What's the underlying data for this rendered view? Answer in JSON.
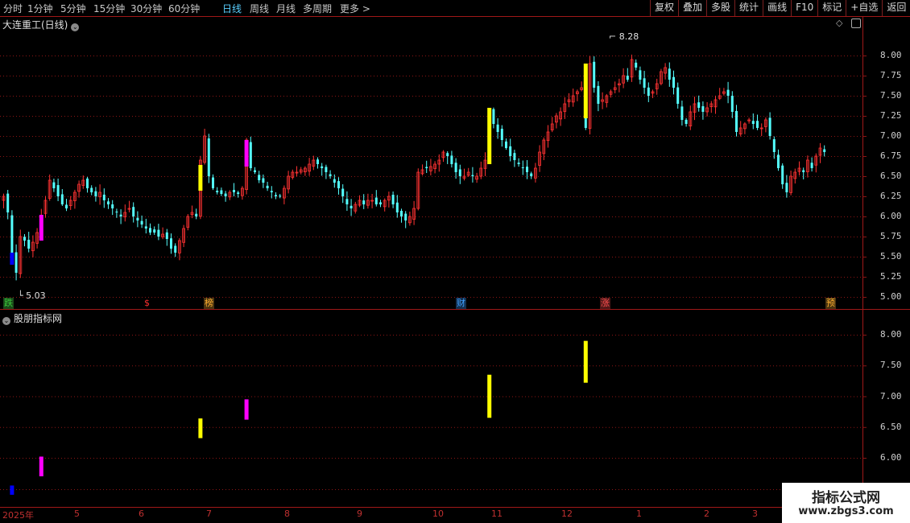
{
  "toolbar": {
    "periods": [
      "分时",
      "1分钟",
      "5分钟",
      "15分钟",
      "30分钟",
      "60分钟",
      "日线",
      "周线",
      "月线",
      "多周期",
      "更多 >"
    ],
    "active_period": "日线",
    "actions": [
      "复权",
      "叠加",
      "多股",
      "统计",
      "画线",
      "F10",
      "标记",
      "+自选",
      "返回"
    ]
  },
  "main_panel": {
    "title": "大连重工(日线)"
  },
  "indicator_panel": {
    "title": "股朋指标网"
  },
  "price_axis": [
    "8.00",
    "7.75",
    "7.50",
    "7.25",
    "7.00",
    "6.75",
    "6.50",
    "6.25",
    "6.00",
    "5.75",
    "5.50",
    "5.25",
    "5.00"
  ],
  "indicator_axis": [
    "8.00",
    "7.50",
    "7.00",
    "6.50",
    "6.00"
  ],
  "annotations": {
    "high": "8.28",
    "low": "5.03"
  },
  "event_markers": [
    {
      "label": "跌",
      "color": "#3ac83a",
      "type": "box"
    },
    {
      "label": "$",
      "color": "#ff3030",
      "type": "text"
    },
    {
      "label": "榜",
      "color": "#ffb030",
      "type": "box"
    },
    {
      "label": "财",
      "color": "#40a0ff",
      "type": "box"
    },
    {
      "label": "涨",
      "color": "#ff5050",
      "type": "box"
    },
    {
      "label": "预",
      "color": "#ffb030",
      "type": "box"
    }
  ],
  "date_axis": [
    "2025年",
    "5",
    "6",
    "7",
    "8",
    "9",
    "10",
    "11",
    "12",
    "1",
    "2",
    "3"
  ],
  "watermark": {
    "title": "指标公式网",
    "url": "www.zbgs3.com"
  },
  "colors": {
    "up": "#ff3232",
    "down": "#54ffff",
    "grid": "#8c1515",
    "signal_yellow": "#ffff00",
    "signal_magenta": "#ff00ff",
    "signal_blue": "#0000ff"
  },
  "chart_data": {
    "type": "candlestick",
    "ylim": [
      4.9,
      8.45
    ],
    "signals": [
      {
        "index": 2,
        "color": "blue",
        "low": 5.4,
        "high": 5.55
      },
      {
        "index": 9,
        "color": "magenta",
        "low": 5.7,
        "high": 6.02
      },
      {
        "index": 47,
        "color": "yellow",
        "low": 6.32,
        "high": 6.64
      },
      {
        "index": 58,
        "color": "magenta",
        "low": 6.62,
        "high": 6.95
      },
      {
        "index": 116,
        "color": "yellow",
        "low": 6.65,
        "high": 7.35
      },
      {
        "index": 139,
        "color": "yellow",
        "low": 7.22,
        "high": 7.9
      }
    ],
    "closes": [
      6.25,
      6.05,
      5.55,
      5.3,
      5.75,
      5.7,
      5.6,
      5.68,
      5.8,
      6.0,
      6.2,
      6.45,
      6.35,
      6.25,
      6.15,
      6.1,
      6.2,
      6.3,
      6.4,
      6.45,
      6.35,
      6.3,
      6.25,
      6.3,
      6.2,
      6.15,
      6.1,
      6.05,
      6.0,
      6.05,
      6.1,
      6.0,
      5.95,
      5.9,
      5.85,
      5.8,
      5.8,
      5.75,
      5.78,
      5.72,
      5.6,
      5.55,
      5.7,
      5.85,
      6.0,
      6.05,
      6.0,
      6.7,
      7.0,
      6.5,
      6.35,
      6.3,
      6.28,
      6.25,
      6.3,
      6.3,
      6.28,
      6.35,
      6.95,
      6.6,
      6.55,
      6.45,
      6.42,
      6.35,
      6.3,
      6.25,
      6.25,
      6.35,
      6.5,
      6.55,
      6.55,
      6.58,
      6.6,
      6.65,
      6.7,
      6.65,
      6.6,
      6.55,
      6.5,
      6.42,
      6.35,
      6.25,
      6.15,
      6.1,
      6.15,
      6.2,
      6.15,
      6.2,
      6.2,
      6.15,
      6.15,
      6.2,
      6.25,
      6.15,
      6.05,
      6.0,
      5.95,
      6.0,
      6.1,
      6.55,
      6.58,
      6.6,
      6.62,
      6.65,
      6.7,
      6.8,
      6.75,
      6.65,
      6.55,
      6.5,
      6.5,
      6.55,
      6.5,
      6.5,
      6.6,
      6.7,
      7.3,
      7.15,
      7.05,
      6.95,
      6.85,
      6.75,
      6.7,
      6.65,
      6.6,
      6.55,
      6.5,
      6.6,
      6.8,
      6.95,
      7.05,
      7.15,
      7.25,
      7.3,
      7.4,
      7.45,
      7.5,
      7.55,
      7.6,
      7.1,
      7.9,
      7.6,
      7.4,
      7.45,
      7.5,
      7.55,
      7.6,
      7.65,
      7.75,
      7.7,
      7.95,
      7.85,
      7.7,
      7.6,
      7.5,
      7.55,
      7.65,
      7.8,
      7.85,
      7.7,
      7.6,
      7.4,
      7.2,
      7.15,
      7.3,
      7.4,
      7.35,
      7.3,
      7.35,
      7.4,
      7.45,
      7.5,
      7.55,
      7.5,
      7.3,
      7.05,
      7.1,
      7.15,
      7.2,
      7.15,
      7.1,
      7.1,
      7.2,
      7.0,
      6.8,
      6.6,
      6.4,
      6.3,
      6.5,
      6.55,
      6.6,
      6.55,
      6.7,
      6.6,
      6.75,
      6.85,
      6.8
    ]
  }
}
